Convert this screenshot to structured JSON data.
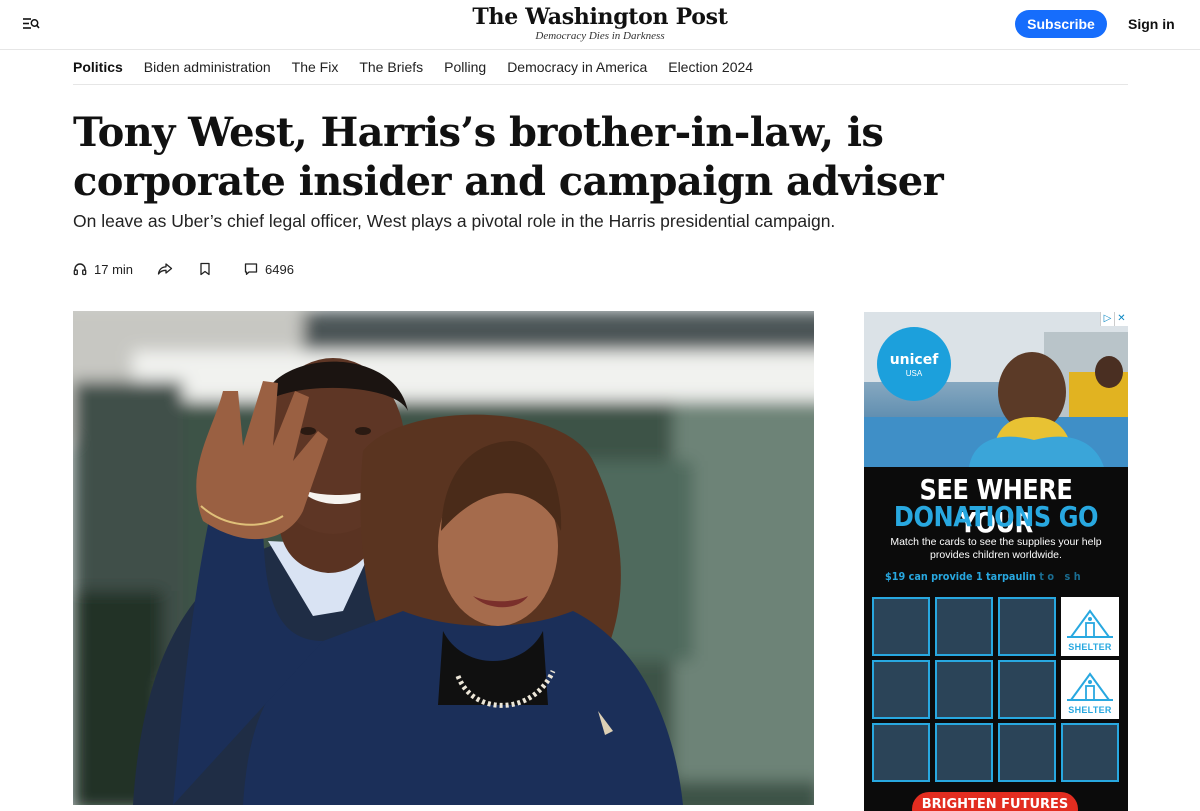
{
  "header": {
    "logo": "The Washington Post",
    "tagline": "Democracy Dies in Darkness",
    "subscribe_label": "Subscribe",
    "signin_label": "Sign in",
    "accent_color": "#166dfc"
  },
  "section_nav": {
    "items": [
      {
        "label": "Politics",
        "active": true
      },
      {
        "label": "Biden administration"
      },
      {
        "label": "The Fix"
      },
      {
        "label": "The Briefs"
      },
      {
        "label": "Polling"
      },
      {
        "label": "Democracy in America"
      },
      {
        "label": "Election 2024"
      }
    ]
  },
  "article": {
    "headline": "Tony West, Harris’s brother-in-law, is corporate insider and campaign adviser",
    "dek": "On leave as Uber’s chief legal officer, West plays a pivotal role in the Harris presidential campaign.",
    "listen_time": "17 min",
    "comment_count": "6496",
    "icons": [
      "headphones-icon",
      "share-icon",
      "bookmark-icon",
      "comment-icon"
    ]
  },
  "ad": {
    "brand_name": "unicef",
    "brand_sub": "USA",
    "headline_line1": "SEE WHERE YOUR",
    "headline_line2": "DONATIONS GO",
    "body": "Match the cards to see the supplies your help provides children worldwide.",
    "offer_text": "$19 can provide 1 tarpaulin",
    "offer_fade": "to sh",
    "card_label": "SHELTER",
    "cta": "BRIGHTEN FUTURES",
    "colors": {
      "accent": "#28a8e0",
      "cta": "#e22d20",
      "card": "#2b4458"
    }
  }
}
